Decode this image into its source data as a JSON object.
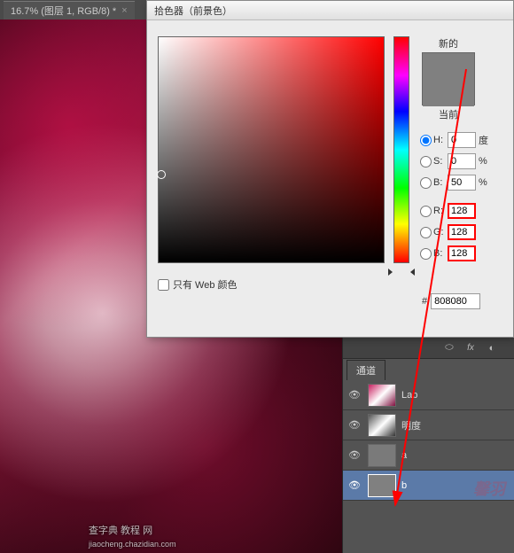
{
  "tab": {
    "title": "16.7% (图层 1, RGB/8) *",
    "close": "×"
  },
  "dialog": {
    "title": "拾色器（前景色）",
    "preview_new": "新的",
    "preview_current": "当前",
    "web_only_label": "只有 Web 颜色",
    "hsb": {
      "h_label": "H:",
      "h_val": "0",
      "h_unit": "度",
      "s_label": "S:",
      "s_val": "0",
      "s_unit": "%",
      "b_label": "B:",
      "b_val": "50",
      "b_unit": "%"
    },
    "rgb": {
      "r_label": "R:",
      "r_val": "128",
      "g_label": "G:",
      "g_val": "128",
      "b_label": "B:",
      "b_val": "128"
    },
    "hex_label": "#",
    "hex_val": "808080"
  },
  "panels": {
    "channels_tab": "通道",
    "channels": [
      {
        "label": "Lab"
      },
      {
        "label": "明度"
      },
      {
        "label": "a"
      },
      {
        "label": "b"
      }
    ]
  },
  "watermark": "查字典 教程 网",
  "watermark_url": "jiaocheng.chazidian.com",
  "watermark2": "馨羽"
}
